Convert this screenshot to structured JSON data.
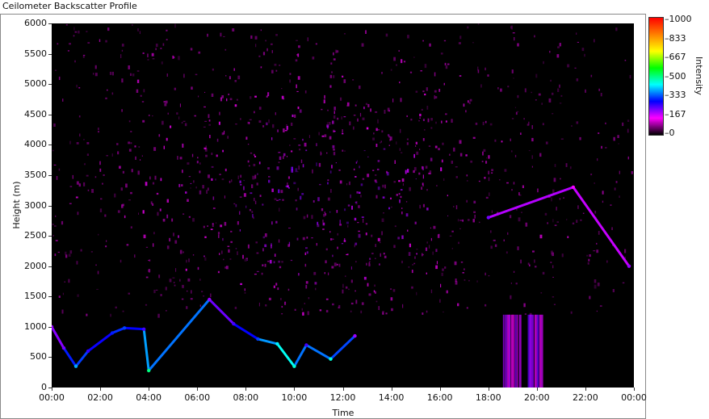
{
  "window": {
    "title": "Ceilometer Backscatter Profile"
  },
  "chart_data": {
    "type": "heatmap",
    "title": "",
    "xlabel": "Time",
    "ylabel": "Height (m)",
    "x_ticks": [
      "00:00",
      "02:00",
      "04:00",
      "06:00",
      "08:00",
      "10:00",
      "12:00",
      "14:00",
      "16:00",
      "18:00",
      "20:00",
      "22:00",
      "00:00"
    ],
    "xlim_hours": [
      0,
      24
    ],
    "y_ticks": [
      0,
      500,
      1000,
      1500,
      2000,
      2500,
      3000,
      3500,
      4000,
      4500,
      5000,
      5500,
      6000
    ],
    "ylim": [
      0,
      6000
    ],
    "colorbar": {
      "label": "Intensity",
      "ticks": [
        "1000",
        "833",
        "667",
        "500",
        "333",
        "167",
        "0"
      ],
      "range": [
        0,
        1000
      ],
      "colors": [
        "#000000",
        "#ff00ff",
        "#0000ff",
        "#00ffff",
        "#00ff00",
        "#ffff00",
        "#ff8000",
        "#ff0000"
      ]
    },
    "background_color": "#000000",
    "layer_structure": [
      {
        "hour_start": 0.0,
        "height_m": 1000,
        "intensity": 200
      },
      {
        "hour_start": 0.5,
        "height_m": 650,
        "intensity": 220
      },
      {
        "hour_start": 1.0,
        "height_m": 350,
        "intensity": 380
      },
      {
        "hour_start": 1.5,
        "height_m": 600,
        "intensity": 260
      },
      {
        "hour_start": 2.5,
        "height_m": 900,
        "intensity": 300
      },
      {
        "hour_start": 3.0,
        "height_m": 980,
        "intensity": 320
      },
      {
        "hour_start": 3.8,
        "height_m": 960,
        "intensity": 250
      },
      {
        "hour_start": 4.0,
        "height_m": 280,
        "intensity": 500
      },
      {
        "hour_start": 6.5,
        "height_m": 1450,
        "intensity": 200
      },
      {
        "hour_start": 7.5,
        "height_m": 1050,
        "intensity": 250
      },
      {
        "hour_start": 8.5,
        "height_m": 800,
        "intensity": 320
      },
      {
        "hour_start": 9.3,
        "height_m": 720,
        "intensity": 420
      },
      {
        "hour_start": 10.0,
        "height_m": 350,
        "intensity": 450
      },
      {
        "hour_start": 10.5,
        "height_m": 700,
        "intensity": 250
      },
      {
        "hour_start": 11.5,
        "height_m": 470,
        "intensity": 450
      },
      {
        "hour_start": 12.5,
        "height_m": 850,
        "intensity": 200
      },
      {
        "hour_start": 18.0,
        "height_m": 2800,
        "intensity": 220
      },
      {
        "hour_start": 21.5,
        "height_m": 3300,
        "intensity": 150
      },
      {
        "hour_start": 23.8,
        "height_m": 2000,
        "intensity": 200
      }
    ],
    "precipitation_columns": [
      {
        "hour_start": 18.6,
        "hour_end": 19.3,
        "top_m": 1200,
        "intensity": 180
      },
      {
        "hour_start": 19.6,
        "hour_end": 20.2,
        "top_m": 1200,
        "intensity": 200
      }
    ]
  }
}
